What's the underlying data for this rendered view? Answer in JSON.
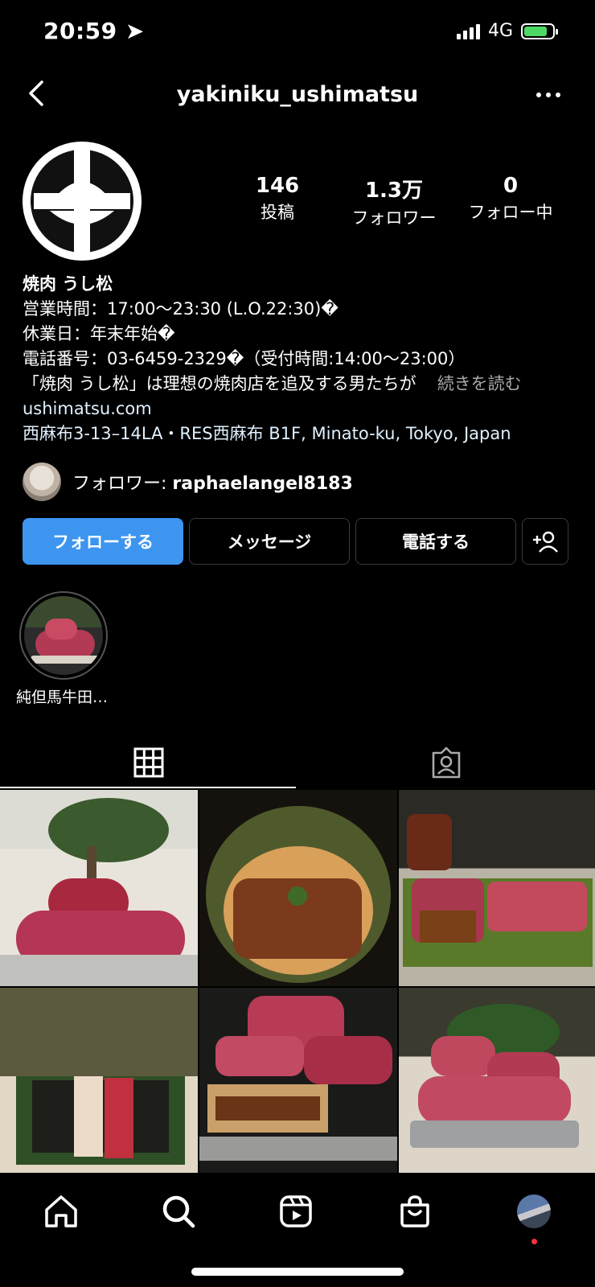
{
  "status": {
    "time": "20:59",
    "network": "4G"
  },
  "header": {
    "username": "yakiniku_ushimatsu"
  },
  "stats": [
    {
      "value": "146",
      "label": "投稿"
    },
    {
      "value": "1.3万",
      "label": "フォロワー"
    },
    {
      "value": "0",
      "label": "フォロー中"
    }
  ],
  "bio": {
    "name": "焼肉 うし松",
    "hours": "営業時間：17:00～23:30 (L.O.22:30)�",
    "holiday": "休業日：年末年始�",
    "phone": "電話番号：03-6459-2329�（受付時間:14:00～23:00）",
    "desc": "「焼肉 うし松」は理想の焼肉店を追及する男たちが",
    "more": "続きを読む",
    "link": "ushimatsu.com",
    "address": "西麻布3-13–14LA・RES西麻布 B1F, Minato-ku, Tokyo, Japan"
  },
  "followed_by": {
    "prefix": "フォロワー: ",
    "user": "raphaelangel8183"
  },
  "buttons": {
    "follow": "フォローする",
    "message": "メッセージ",
    "call": "電話する"
  },
  "highlight": {
    "label": "純但馬牛田…"
  },
  "colors": {
    "accent": "#3d95ef",
    "notification": "#ff3040"
  },
  "nav": [
    "home-icon",
    "search-icon",
    "reels-icon",
    "shop-icon",
    "profile-avatar"
  ]
}
